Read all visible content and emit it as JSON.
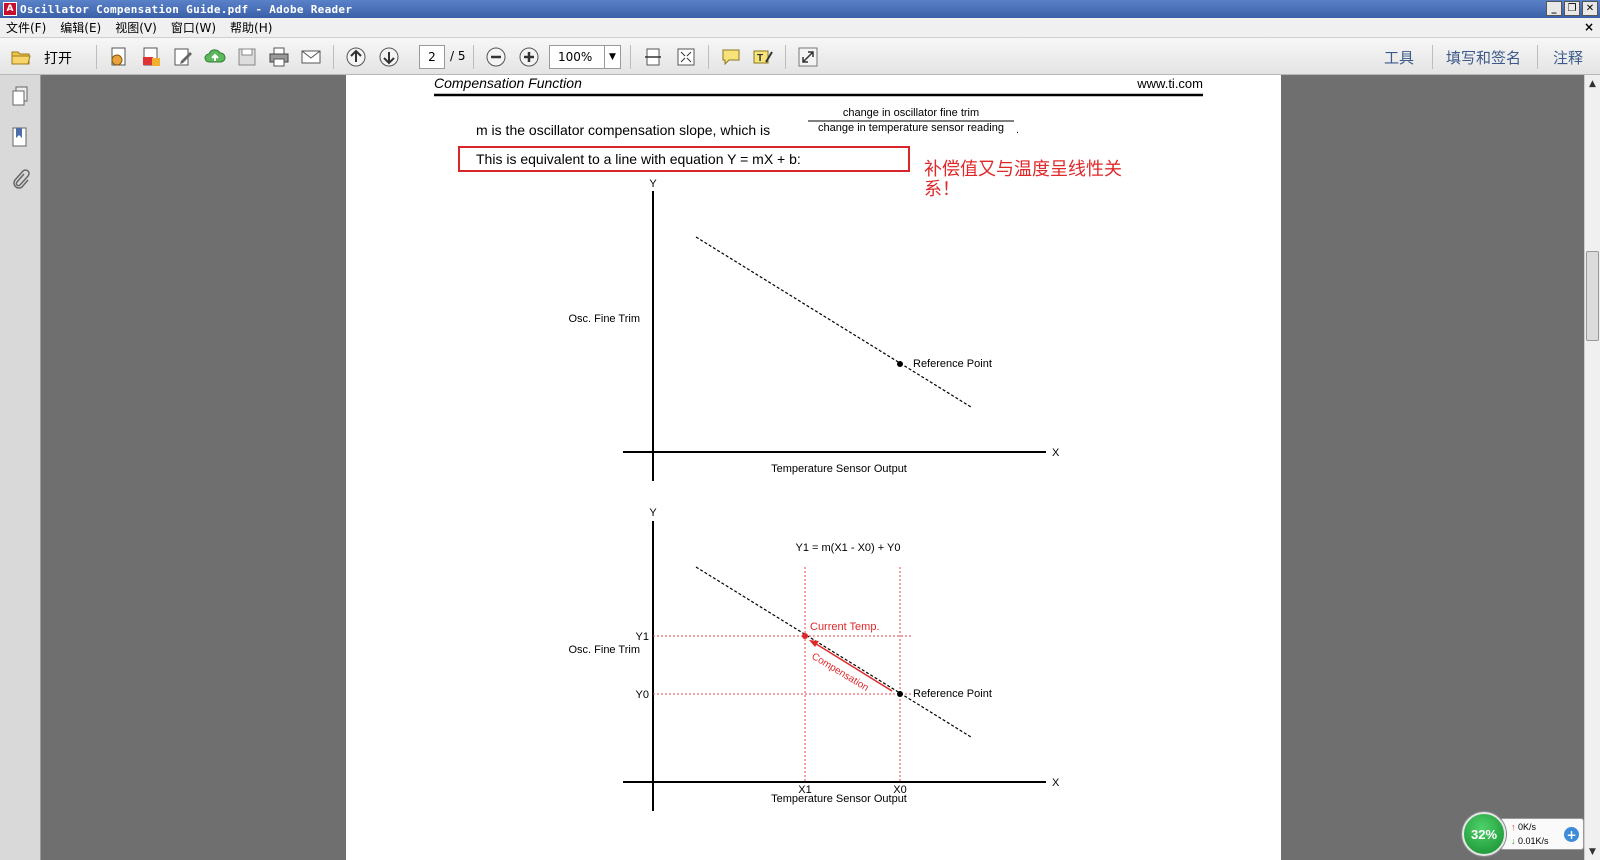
{
  "window": {
    "title": "Oscillator Compensation Guide.pdf - Adobe Reader",
    "controls": [
      "_",
      "❐",
      "✕"
    ]
  },
  "menubar": {
    "items": [
      "文件(F)",
      "编辑(E)",
      "视图(V)",
      "窗口(W)",
      "帮助(H)"
    ],
    "close_doc": "×"
  },
  "toolbar": {
    "open_label": "打开",
    "page_current": "2",
    "page_total": "/ 5",
    "zoom": "100%",
    "right_tabs": [
      "工具",
      "填写和签名",
      "注释"
    ]
  },
  "document": {
    "header_left": "Compensation Function",
    "header_right": "www.ti.com",
    "slope_text": "m is the oscillator compensation slope, which is",
    "fraction_numerator": "change in oscillator fine trim",
    "fraction_denominator": "change in temperature sensor reading",
    "fraction_period": ".",
    "equation_text": "This is equivalent to a line with equation Y = mX + b:",
    "annotation_line1": "补偿值又与温度呈线性关",
    "annotation_line2": "系！",
    "chart1": {
      "y_axis": "Y",
      "x_axis": "X",
      "ylabel": "Osc. Fine Trim",
      "xlabel": "Temperature Sensor Output",
      "point_label": "Reference Point"
    },
    "chart2": {
      "y_axis": "Y",
      "x_axis": "X",
      "ylabel": "Osc. Fine Trim",
      "xlabel": "Temperature Sensor Output",
      "formula": "Y1 = m(X1 - X0) + Y0",
      "current_label": "Current Temp.",
      "compensation_label": "Compensation",
      "reference_label": "Reference Point",
      "y1": "Y1",
      "y0": "Y0",
      "x1": "X1",
      "x0": "X0"
    }
  },
  "network_widget": {
    "percent": "32%",
    "upload": "0K/s",
    "download": "0.01K/s",
    "plus": "+"
  },
  "colors": {
    "annotation_red": "#e0282a",
    "box_red": "#d9262a",
    "guide_red": "#e8454a"
  }
}
